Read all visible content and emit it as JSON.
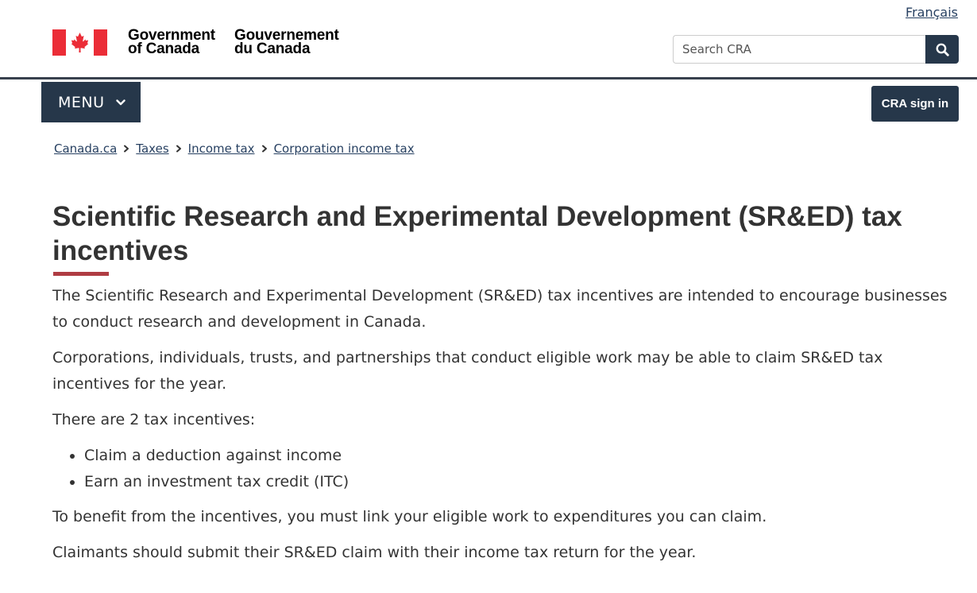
{
  "header": {
    "language_link": "Français",
    "signature_en_line1": "Government",
    "signature_en_line2": "of Canada",
    "signature_fr_line1": "Gouvernement",
    "signature_fr_line2": "du Canada",
    "search_placeholder": "Search CRA",
    "search_button_label": "Search",
    "flag_color": "#eb2d37"
  },
  "navbar": {
    "menu_label": "MENU",
    "signin_label": "CRA sign in",
    "button_color": "#26374a"
  },
  "breadcrumb": {
    "items": [
      {
        "label": "Canada.ca"
      },
      {
        "label": "Taxes"
      },
      {
        "label": "Income tax"
      },
      {
        "label": "Corporation income tax"
      }
    ]
  },
  "main": {
    "title": "Scientific Research and Experimental Development (SR&ED) tax incentives",
    "intro": "The Scientific Research and Experimental Development (SR&ED) tax incentives are intended to encourage businesses to conduct research and development in Canada.",
    "eligibility": "Corporations, individuals, trusts, and partnerships that conduct eligible work may be able to claim SR&ED tax incentives for the year.",
    "incentives_lead": "There are 2 tax incentives:",
    "incentives": [
      "Claim a deduction against income",
      "Earn an investment tax credit (ITC)"
    ],
    "benefit_note": "To benefit from the incentives, you must link your eligible work to expenditures you can claim.",
    "submit_note": "Claimants should submit their SR&ED claim with their income tax return for the year.",
    "accent_color": "#af3c43",
    "link_color": "#284162"
  }
}
